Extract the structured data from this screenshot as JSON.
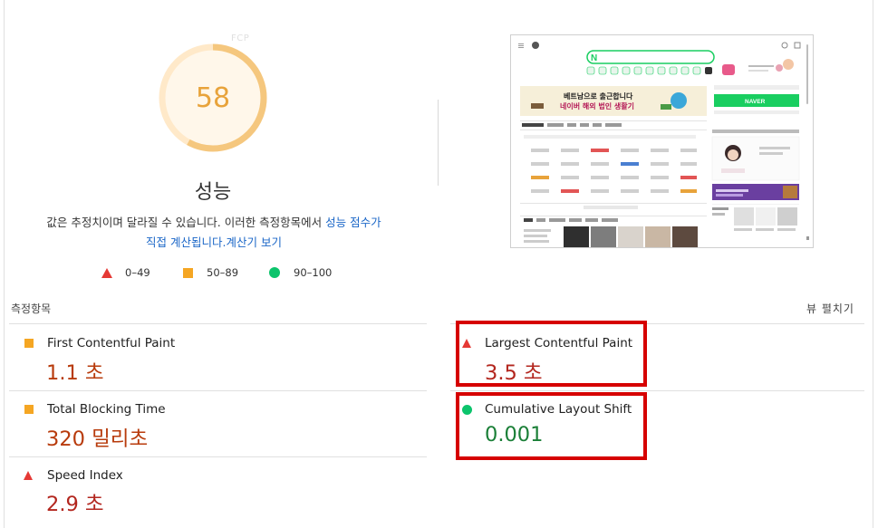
{
  "gauge": {
    "score": "58",
    "fcp_tag": "FCP",
    "fraction": 0.58,
    "color": "#f5a623"
  },
  "performance": {
    "title": "성능",
    "desc_plain": "값은 추정치이며 달라질 수 있습니다. 이러한 측정항목에서 ",
    "desc_link1": "성능 점수가",
    "desc_link1b": "직접 계산됩니다.",
    "desc_link2": "계산기 보기"
  },
  "legend": [
    {
      "icon": "triangle",
      "label": "0–49",
      "color": "#e53935"
    },
    {
      "icon": "square",
      "label": "50–89",
      "color": "#f5a623"
    },
    {
      "icon": "circle",
      "label": "90–100",
      "color": "#0cc46c"
    }
  ],
  "metrics_section": {
    "title": "측정항목",
    "expand_label": "뷰 펼치기"
  },
  "metrics": [
    {
      "name": "First Contentful Paint",
      "value": "1.1 초",
      "rating": "average"
    },
    {
      "name": "Largest Contentful Paint",
      "value": "3.5 초",
      "rating": "fail"
    },
    {
      "name": "Total Blocking Time",
      "value": "320 밀리초",
      "rating": "average"
    },
    {
      "name": "Cumulative Layout Shift",
      "value": "0.001",
      "rating": "pass"
    },
    {
      "name": "Speed Index",
      "value": "2.9 초",
      "rating": "fail"
    }
  ],
  "thumbnail": {
    "banner_line1": "베트남으로 출근합니다",
    "banner_line2": "네이버 해외 법인 생활기",
    "login_button": "NAVER",
    "logo": "N"
  },
  "colors": {
    "fail": "#e53935",
    "average": "#f5a623",
    "pass": "#0cc46c",
    "highlight": "#d60000",
    "link": "#1a66c7"
  }
}
